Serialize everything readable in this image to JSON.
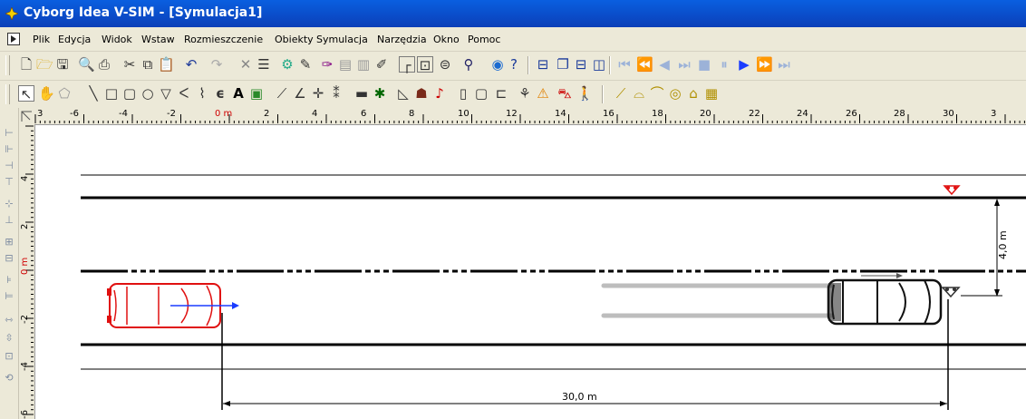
{
  "window": {
    "title": "Cyborg Idea V-SIM - [Symulacja1]"
  },
  "menu": {
    "items": [
      "Plik",
      "Edycja",
      "Widok",
      "Wstaw",
      "Rozmieszczenie",
      "Obiekty",
      "Symulacja",
      "Narzędzia",
      "Okno",
      "Pomoc"
    ]
  },
  "toolbar1": {
    "icons": [
      "new-icon",
      "open-icon",
      "save-icon",
      "print-preview-icon",
      "print-icon",
      "cut-icon",
      "copy-icon",
      "paste-icon",
      "undo-icon",
      "redo-icon",
      "delete-icon",
      "properties-icon",
      "vehicle-properties-icon",
      "pen-icon",
      "trajectory-icon",
      "database-icon",
      "stack-icon",
      "edit-icon",
      "road-shape-icon",
      "road-cross-icon",
      "road-layers-icon",
      "zoom-icon",
      "globe-icon",
      "help-icon",
      "layout-icon",
      "window-cascade-icon",
      "window-tile-icon",
      "window-columns-icon",
      "skip-start-icon",
      "rewind-icon",
      "step-back-icon",
      "fast-back-icon",
      "stop-icon",
      "pause-icon",
      "play-icon",
      "fast-forward-icon",
      "skip-end-icon"
    ]
  },
  "toolbar2": {
    "icons": [
      "select-arrow-icon",
      "hand-icon",
      "vertex-icon",
      "line-icon",
      "rectangle-icon",
      "rounded-rect-icon",
      "ellipse-icon",
      "polygon-icon",
      "polyline-icon",
      "curve-icon",
      "ce-mark-icon",
      "text-icon",
      "image-icon",
      "dimension-icon",
      "angle-icon",
      "crosshair-icon",
      "tire-mark-icon",
      "barrier-icon",
      "tree-icon",
      "slope-icon",
      "person-icon",
      "traffic-light-icon",
      "post-icon",
      "box-icon",
      "scale-icon",
      "motorcycle-icon",
      "warning-sign-icon",
      "car-icon",
      "pedestrian-icon",
      "measure-icon",
      "bridge-icon",
      "tunnel-icon",
      "roundabout-icon",
      "garage-icon",
      "fence-icon"
    ]
  },
  "ruler": {
    "top_labels": [
      "3",
      "-6",
      "-4",
      "-2",
      "0 m",
      "2",
      "4",
      "6",
      "8",
      "10",
      "12",
      "14",
      "16",
      "18",
      "20",
      "22",
      "24",
      "26",
      "28",
      "30",
      "3"
    ],
    "left_labels": [
      "4",
      "2",
      "0 m",
      "-2",
      "-4",
      "-6"
    ]
  },
  "scene": {
    "distance_label": "30,0 m",
    "lateral_label": "4,0 m",
    "colors": {
      "vehicle1": "#e01010",
      "vehicle2": "#111111",
      "velocity_arrow": "#1a3cff",
      "skid": "#bdbdbd"
    }
  }
}
